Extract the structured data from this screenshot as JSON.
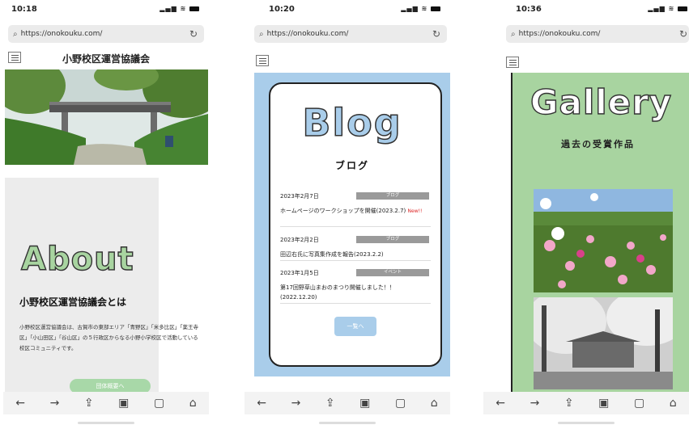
{
  "phones": [
    {
      "time": "10:18",
      "url": "https://onokouku.com/",
      "site_title": "小野校区運営協議会",
      "about_heading": "About",
      "about_subheading": "小野校区運営協議会とは",
      "about_text": "小野校区運営協議会は、古賀市の東部エリア「青野区」「米多比区」「薬王寺区」「小山田区」「谷山区」の５行政区からなる小野小学校区で活動している校区コミュニティです。",
      "button_label": "団体概要へ"
    },
    {
      "time": "10:20",
      "url": "https://onokouku.com/",
      "blog_heading": "Blog",
      "blog_subheading": "ブログ",
      "posts": [
        {
          "date": "2023年2月7日",
          "category": "ブログ",
          "title": "ホームページのワークショップを開催(2023.2.7)",
          "new_badge": "New!!"
        },
        {
          "date": "2023年2月2日",
          "category": "ブログ",
          "title": "田辺右氏に写真集作成を報告(2023.2.2)",
          "new_badge": ""
        },
        {
          "date": "2023年1月5日",
          "category": "イベント",
          "title": "第17回野草山まおのまつり開催しました！！(2022.12.20)",
          "new_badge": ""
        }
      ],
      "button_label": "一覧へ"
    },
    {
      "time": "10:36",
      "url": "https://onokouku.com/",
      "gallery_heading": "Gallery",
      "gallery_subheading": "過去の受賞作品"
    }
  ],
  "colors": {
    "green": "#a8d4a0",
    "blue": "#a9cdea"
  },
  "icons": [
    "back-icon",
    "forward-icon",
    "share-icon",
    "bookmarks-icon",
    "tabs-icon",
    "home-icon"
  ]
}
